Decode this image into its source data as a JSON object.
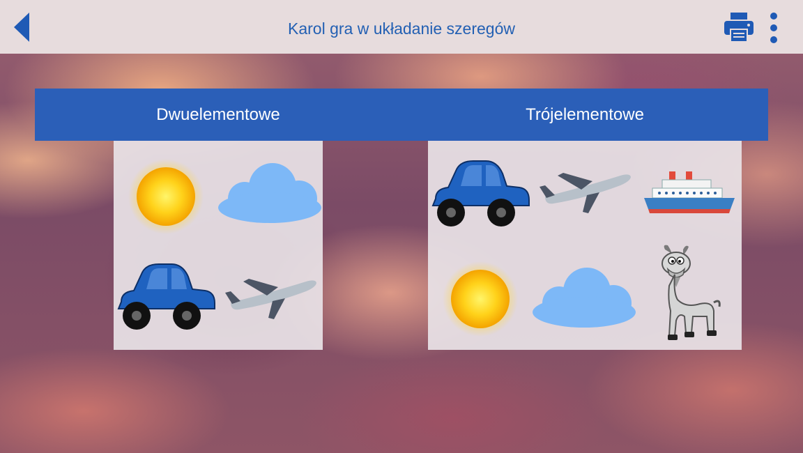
{
  "header": {
    "title": "Karol gra w układanie szeregów",
    "back_icon": "back-arrow-icon",
    "print_icon": "printer-icon",
    "menu_icon": "more-vert-icon"
  },
  "tabs": [
    {
      "label": "Dwuelementowe"
    },
    {
      "label": "Trójelementowe"
    }
  ],
  "cards": {
    "two_element": {
      "items": [
        "sun",
        "cloud",
        "car",
        "airplane"
      ]
    },
    "three_element": {
      "items": [
        "car",
        "airplane",
        "ship",
        "sun",
        "cloud",
        "goat"
      ]
    }
  },
  "colors": {
    "accent": "#2360b3",
    "tab_bar": "#2b5fb8",
    "topbar": "#e7dcdd"
  }
}
